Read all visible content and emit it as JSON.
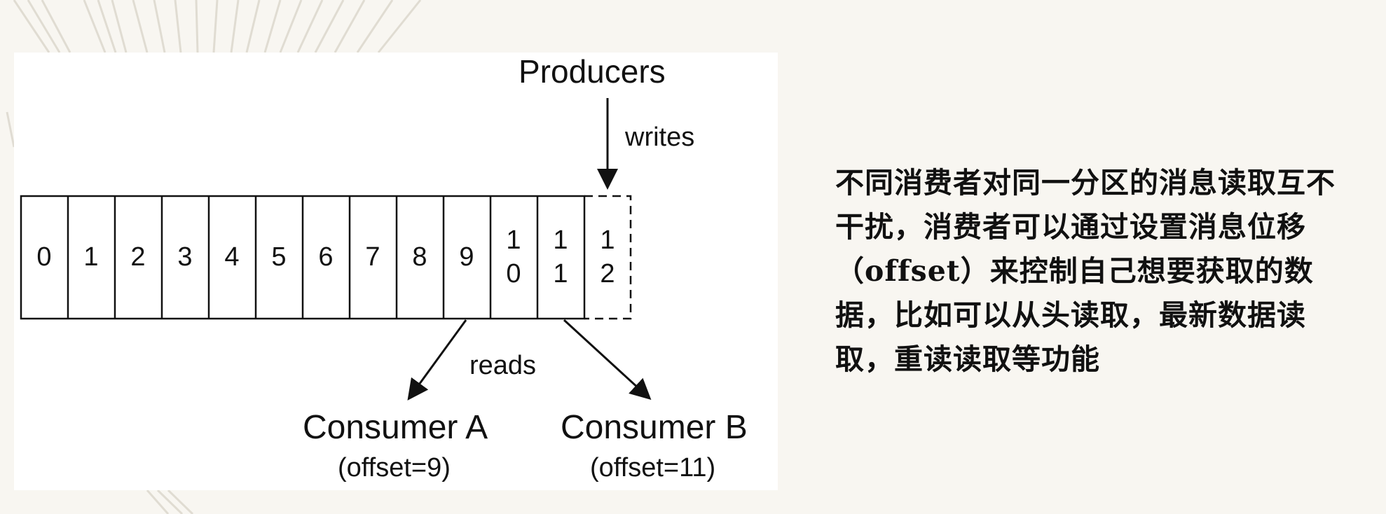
{
  "diagram": {
    "producers_label": "Producers",
    "writes_label": "writes",
    "reads_label": "reads",
    "consumer_a": {
      "name": "Consumer A",
      "offset": "(offset=9)"
    },
    "consumer_b": {
      "name": "Consumer B",
      "offset": "(offset=11)"
    },
    "partition_cells": [
      "0",
      "1",
      "2",
      "3",
      "4",
      "5",
      "6",
      "7",
      "8",
      "9",
      "10",
      "11"
    ],
    "pending_cell": "12"
  },
  "description": {
    "text": "不同消费者对同一分区的消息读取互不干扰，消费者可以通过设置消息位移（offset）来控制自己想要获取的数据，比如可以从头读取，最新数据读取，重读读取等功能"
  }
}
